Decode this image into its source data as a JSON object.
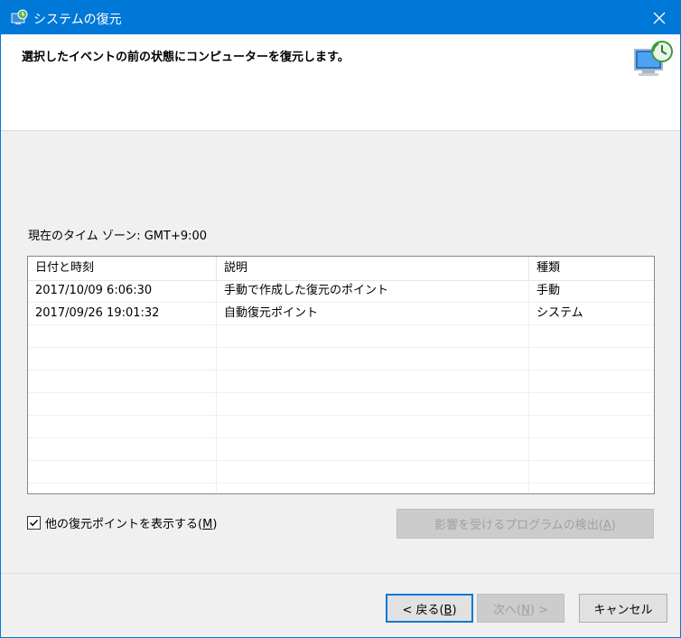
{
  "window": {
    "title": "システムの復元",
    "accent_color": "#0078d7",
    "icons": {
      "app": "system-restore-icon",
      "close": "close-icon",
      "header": "computer-restore-icon"
    }
  },
  "header": {
    "instruction": "選択したイベントの前の状態にコンピューターを復元します。"
  },
  "timezone_label": "現在のタイム ゾーン: GMT+9:00",
  "table": {
    "columns": [
      "日付と時刻",
      "説明",
      "種類"
    ],
    "rows": [
      [
        "2017/10/09 6:06:30",
        "手動で作成した復元のポイント",
        "手動"
      ],
      [
        "2017/09/26 19:01:32",
        "自動復元ポイント",
        "システム"
      ]
    ]
  },
  "show_more": {
    "label": "他の復元ポイントを表示する",
    "accel": "M",
    "checked": true
  },
  "scan_button": {
    "label": "影響を受けるプログラムの検出",
    "accel": "A",
    "enabled": false
  },
  "buttons": {
    "back": {
      "label": "< 戻る",
      "accel": "B"
    },
    "next": {
      "label": "次へ",
      "accel": "N",
      "suffix": " >",
      "enabled": false
    },
    "cancel": {
      "label": "キャンセル"
    }
  }
}
